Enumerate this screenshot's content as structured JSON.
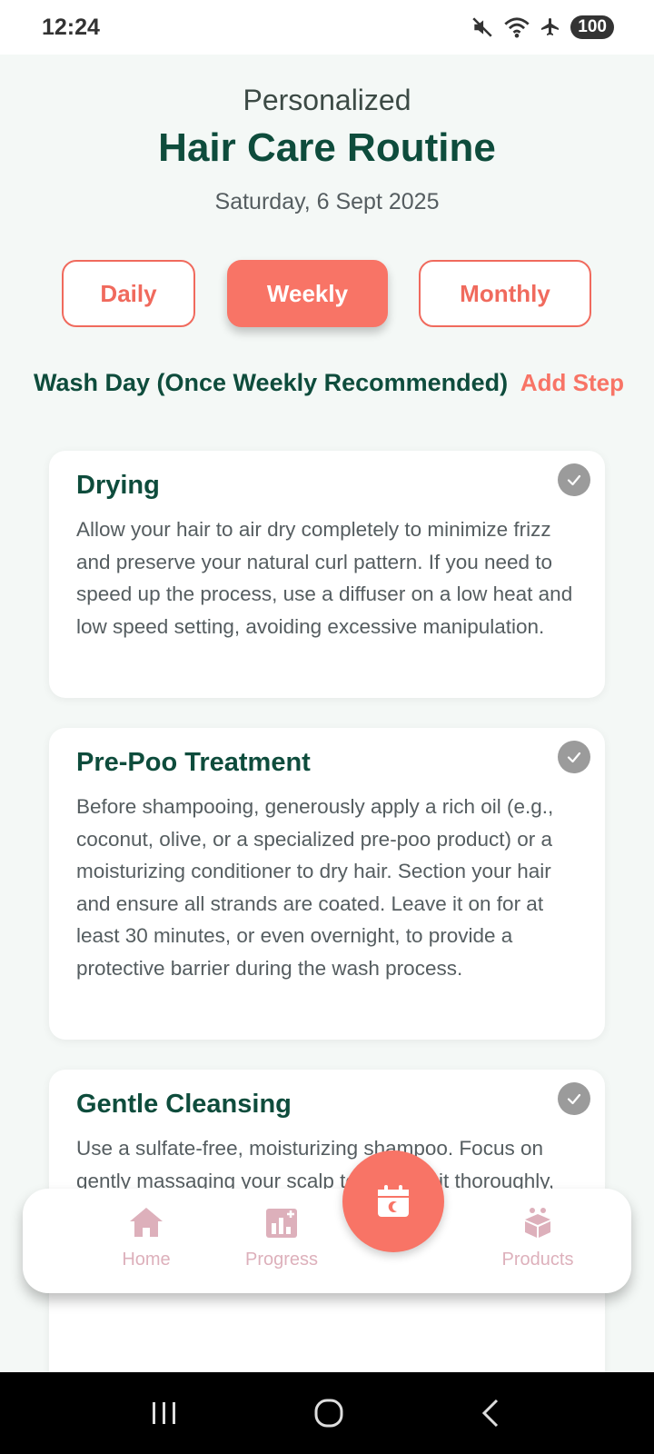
{
  "status_bar": {
    "time": "12:24",
    "battery": "100"
  },
  "header": {
    "subtitle": "Personalized",
    "title": "Hair Care Routine",
    "date": "Saturday, 6 Sept 2025"
  },
  "tabs": [
    {
      "label": "Daily",
      "active": false
    },
    {
      "label": "Weekly",
      "active": true
    },
    {
      "label": "Monthly",
      "active": false
    }
  ],
  "section": {
    "title": "Wash Day (Once Weekly Recommended)",
    "add_step_label": "Add Step"
  },
  "cards": [
    {
      "title": "Drying",
      "text": "Allow your hair to air dry completely to minimize frizz and preserve your natural curl pattern. If you need to speed up the process, use a diffuser on a low heat and low speed setting, avoiding excessive manipulation."
    },
    {
      "title": "Pre-Poo Treatment",
      "text": "Before shampooing, generously apply a rich oil (e.g., coconut, olive, or a specialized pre-poo product) or a moisturizing conditioner to dry hair. Section your hair and ensure all strands are coated. Leave it on for at least 30 minutes, or even overnight, to provide a protective barrier during the wash process."
    },
    {
      "title": "Gentle Cleansing",
      "text": "Use a sulfate-free, moisturizing shampoo. Focus on gently massaging your scalp to cleanse it thoroughly, allowing the suds to run down the lengths of your hair without harsh rubbing."
    }
  ],
  "bottom_nav": {
    "items": [
      {
        "label": "Home",
        "icon": "home-icon"
      },
      {
        "label": "Progress",
        "icon": "progress-chart-icon"
      },
      {
        "label": "Products",
        "icon": "products-box-icon"
      }
    ],
    "fab_icon": "calendar-icon"
  },
  "colors": {
    "primary_green": "#0e4c3c",
    "coral": "#f87466",
    "nav_pink": "#ddb0bb"
  }
}
